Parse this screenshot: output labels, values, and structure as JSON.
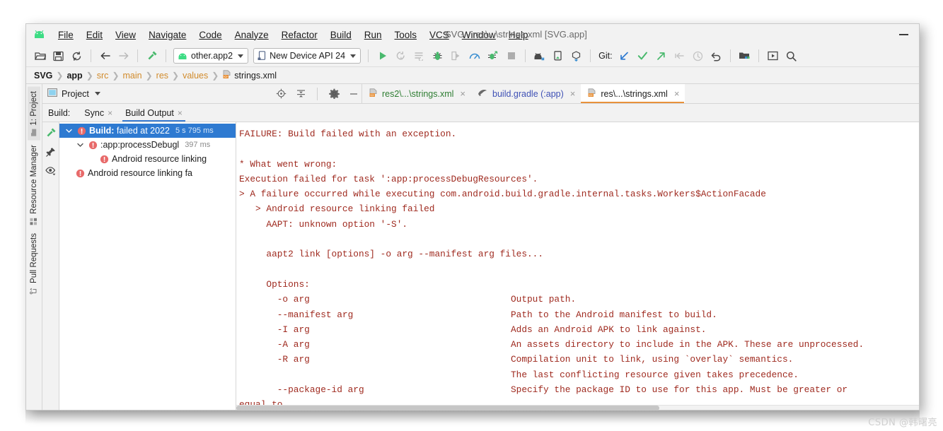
{
  "window": {
    "title": "SVG - res\\...\\strings.xml [SVG.app]",
    "minimize_label": "—"
  },
  "menu": {
    "items": [
      {
        "label": "File",
        "mnemonic": "F"
      },
      {
        "label": "Edit",
        "mnemonic": "E"
      },
      {
        "label": "View",
        "mnemonic": "V"
      },
      {
        "label": "Navigate",
        "mnemonic": "N"
      },
      {
        "label": "Code",
        "mnemonic": "C"
      },
      {
        "label": "Analyze",
        "mnemonic": "z"
      },
      {
        "label": "Refactor",
        "mnemonic": "R"
      },
      {
        "label": "Build",
        "mnemonic": "B"
      },
      {
        "label": "Run",
        "mnemonic": "u"
      },
      {
        "label": "Tools",
        "mnemonic": "T"
      },
      {
        "label": "VCS",
        "mnemonic": "S"
      },
      {
        "label": "Window",
        "mnemonic": "W"
      },
      {
        "label": "Help",
        "mnemonic": "H"
      }
    ]
  },
  "toolbar": {
    "open_icon": "open-folder-icon",
    "save_icon": "save-icon",
    "sync_icon": "sync-project-icon",
    "back_icon": "navigate-back-icon",
    "forward_icon": "navigate-forward-icon",
    "build_icon": "build-hammer-icon",
    "module_selector": "other.app2",
    "device_selector": "New Device API 24",
    "run_icon": "run-icon",
    "apply_changes_icon": "apply-changes-icon",
    "apply_code_icon": "apply-code-changes-icon",
    "debug_icon": "debug-icon",
    "attach_debugger_icon": "attach-debugger-icon",
    "profiler_icon": "profiler-icon",
    "run_with_coverage_icon": "run-coverage-icon",
    "stop_icon": "stop-icon",
    "avd_manager_icon": "avd-manager-icon",
    "sdk_manager_icon": "sdk-manager-icon",
    "device_file_explorer_icon": "device-file-explorer-icon",
    "git_label": "Git:",
    "git_update_icon": "git-update-icon",
    "git_commit_icon": "git-commit-icon",
    "git_push_icon": "git-push-icon",
    "git_branch_icon": "git-branch-icon",
    "git_history_icon": "git-history-icon",
    "git_rollback_icon": "git-rollback-icon",
    "project_structure_icon": "project-structure-icon",
    "select_opened_file_icon": "select-opened-file-icon",
    "search_icon": "search-everywhere-icon"
  },
  "breadcrumb": {
    "items": [
      "SVG",
      "app",
      "src",
      "main",
      "res",
      "values"
    ],
    "file": "strings.xml",
    "file_icon": "xml-file-icon",
    "separator": "❯"
  },
  "left_strip": {
    "tabs": [
      {
        "label": "1: Project",
        "icon": "project-folder-icon",
        "selected": true
      },
      {
        "label": "Resource Manager",
        "icon": "resource-manager-icon",
        "selected": false
      },
      {
        "label": "Pull Requests",
        "icon": "pull-requests-icon",
        "selected": false
      }
    ]
  },
  "project_header": {
    "label": "Project",
    "panel_icon": "project-panel-icon",
    "caret_icon": "chevron-down-icon",
    "locate_icon": "scroll-from-source-icon",
    "collapse_icon": "collapse-all-icon",
    "settings_icon": "gear-icon",
    "hide_icon": "hide-panel-icon"
  },
  "editor_tabs": [
    {
      "label": "res2\\...\\strings.xml",
      "icon": "xml-file-icon",
      "color_class": "green",
      "active": false,
      "close": "×"
    },
    {
      "label": "build.gradle (:app)",
      "icon": "gradle-file-icon",
      "color_class": "blue",
      "active": false,
      "close": "×"
    },
    {
      "label": "res\\...\\strings.xml",
      "icon": "xml-file-icon",
      "color_class": "dark",
      "active": true,
      "close": "×"
    }
  ],
  "build_window": {
    "label": "Build:",
    "tabs": [
      {
        "label": "Sync",
        "active": false,
        "close": "×"
      },
      {
        "label": "Build Output",
        "active": true,
        "close": "×"
      }
    ],
    "side_icons": [
      {
        "name": "build-hammer-icon"
      },
      {
        "name": "pin-icon"
      },
      {
        "name": "eye-filter-icon"
      }
    ],
    "tree": [
      {
        "title_bold": "Build:",
        "title_rest": " failed at 2022",
        "time": "5 s 795 ms",
        "indent": 0,
        "expanded": true,
        "selected": true,
        "status_icon": "error-icon"
      },
      {
        "title_bold": "",
        "title_rest": ":app:processDebugl",
        "time": "397 ms",
        "indent": 1,
        "expanded": true,
        "selected": false,
        "status_icon": "error-icon"
      },
      {
        "title_bold": "",
        "title_rest": "Android resource linking",
        "time": "",
        "indent": 2,
        "expanded": false,
        "selected": false,
        "status_icon": "error-icon"
      },
      {
        "title_bold": "",
        "title_rest": "Android resource linking fa",
        "time": "",
        "indent": 1,
        "expanded": false,
        "selected": false,
        "status_icon": "error-icon"
      }
    ]
  },
  "console": {
    "text_color": "#9f2a1f",
    "lines": [
      "FAILURE: Build failed with an exception.",
      "",
      "* What went wrong:",
      "Execution failed for task ':app:processDebugResources'.",
      "> A failure occurred while executing com.android.build.gradle.internal.tasks.Workers$ActionFacade",
      "   > Android resource linking failed",
      "     AAPT: unknown option '-S'.",
      "",
      "     aapt2 link [options] -o arg --manifest arg files...",
      "",
      "     Options:",
      "       -o arg                                     Output path.",
      "       --manifest arg                             Path to the Android manifest to build.",
      "       -I arg                                     Adds an Android APK to link against.",
      "       -A arg                                     An assets directory to include in the APK. These are unprocessed.",
      "       -R arg                                     Compilation unit to link, using `overlay` semantics.",
      "                                                  The last conflicting resource given takes precedence.",
      "       --package-id arg                           Specify the package ID to use for this app. Must be greater or",
      "equal to"
    ]
  },
  "watermark": "CSDN @韩曙亮"
}
